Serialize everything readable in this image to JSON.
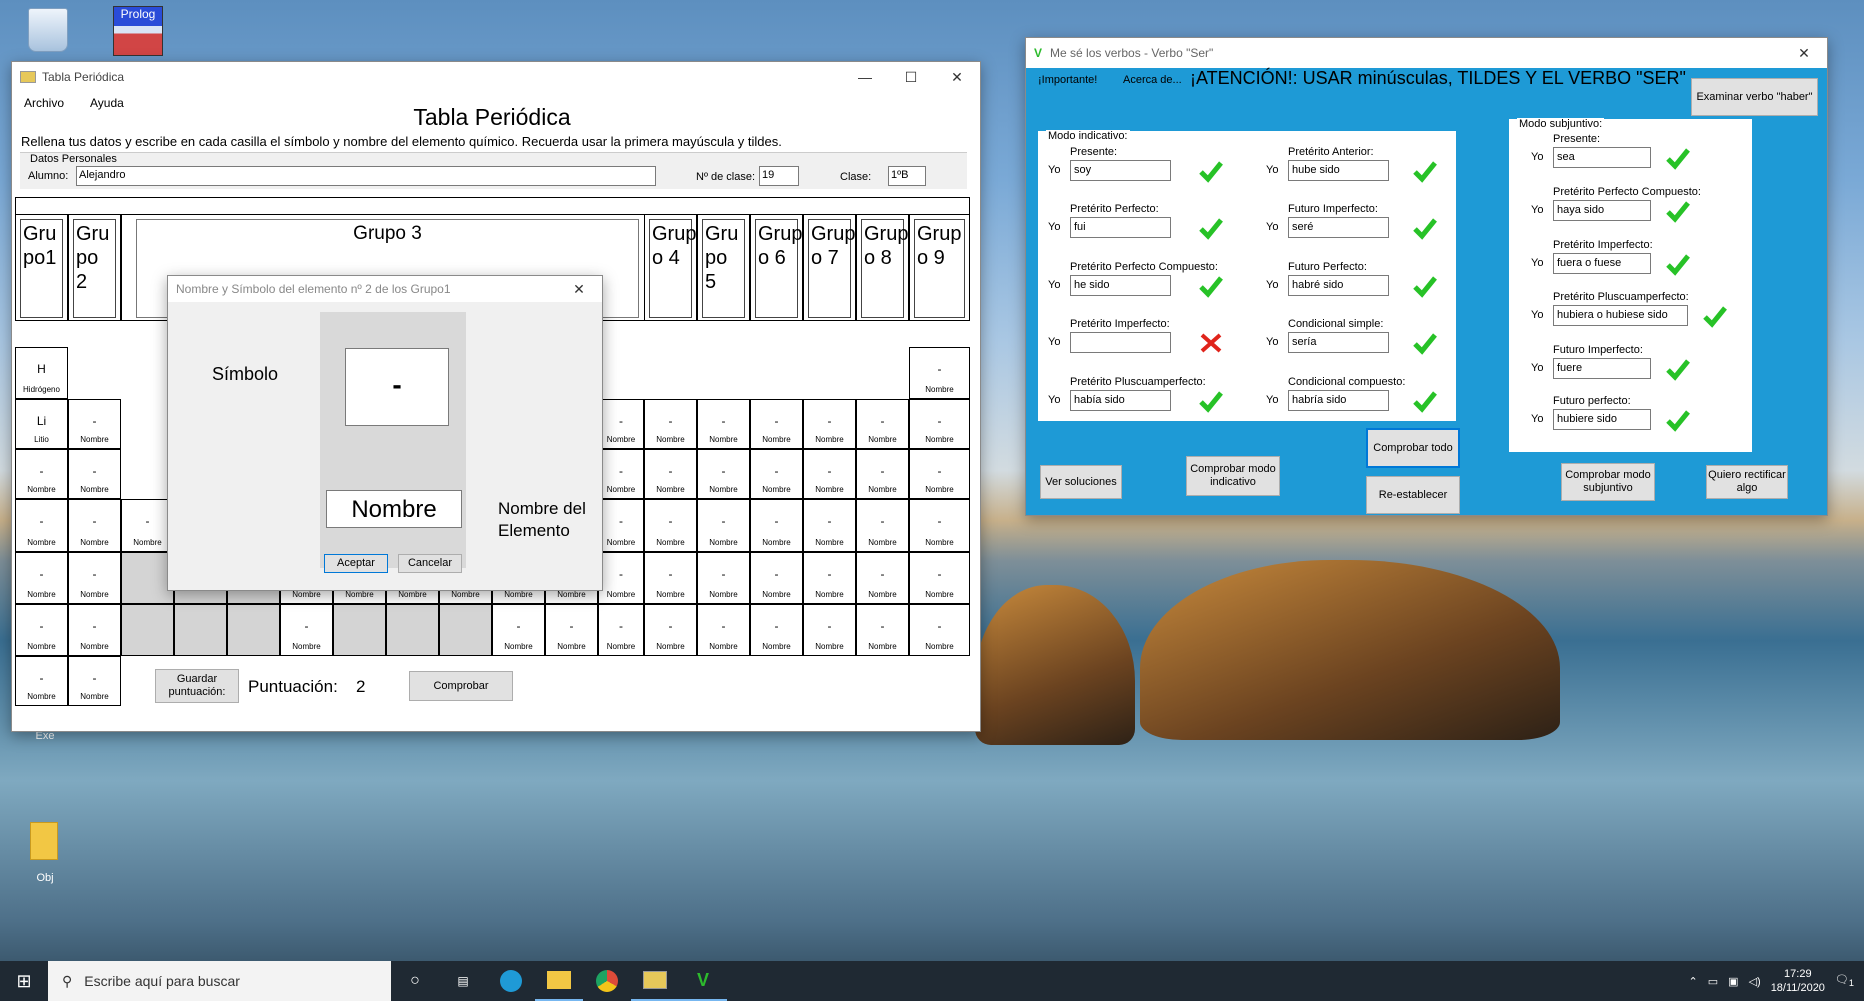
{
  "desktop": {
    "icon_exe": "Exe",
    "icon_obj": "Obj",
    "prolog": "Prolog"
  },
  "tabla": {
    "title": "Tabla Periódica",
    "menu": [
      "Archivo",
      "Ayuda"
    ],
    "heading": "Tabla Periódica",
    "instructions": "Rellena tus datos y escribe en cada casilla el símbolo y nombre del elemento químico. Recuerda usar la primera mayúscula y tildes.",
    "datos_legend": "Datos Personales",
    "alumno_label": "Alumno:",
    "alumno_value": "Alejandro",
    "nclase_label": "Nº de clase:",
    "nclase_value": "19",
    "clase_label": "Clase:",
    "clase_value": "1ºB",
    "groups": [
      "Gru po1",
      "Gru po 2",
      "Grupo 3",
      "Grup o 4",
      "Gru po 5",
      "Grup o 6",
      "Grup o 7",
      "Grup o 8",
      "Grup o 9"
    ],
    "h_symbol": "H",
    "h_name": "Hidrógeno",
    "li_symbol": "Li",
    "li_name": "Litio",
    "empty_symbol": "-",
    "empty_name": "Nombre",
    "save_button": "Guardar puntuación:",
    "score_label": "Puntuación:",
    "score_value": "2",
    "check_button": "Comprobar"
  },
  "dialog": {
    "title": "Nombre y Símbolo del elemento nº 2 de los Grupo1",
    "simbolo_label": "Símbolo",
    "symbol_value": "-",
    "name_value": "Nombre",
    "nombre_label": "Nombre del Elemento",
    "ok": "Aceptar",
    "cancel": "Cancelar"
  },
  "verbos": {
    "title": "Me sé los verbos - Verbo \"Ser\"",
    "menu": [
      "¡Importante!",
      "Acerca de..."
    ],
    "warning": "¡ATENCIÓN!: USAR minúsculas, TILDES Y EL VERBO \"SER\"",
    "examinar": "Examinar verbo \"haber\"",
    "ind_legend": "Modo indicativo:",
    "subj_legend": "Modo subjuntivo:",
    "yo": "Yo",
    "indicativo": [
      {
        "label": "Presente:",
        "value": "soy",
        "ok": true
      },
      {
        "label": "Pretérito Perfecto:",
        "value": "fui",
        "ok": true
      },
      {
        "label": "Pretérito Perfecto Compuesto:",
        "value": "he sido",
        "ok": true
      },
      {
        "label": "Pretérito Imperfecto:",
        "value": "",
        "ok": false
      },
      {
        "label": "Pretérito Pluscuamperfecto:",
        "value": "había sido",
        "ok": true
      },
      {
        "label": "Pretérito Anterior:",
        "value": "hube sido",
        "ok": true
      },
      {
        "label": "Futuro Imperfecto:",
        "value": "seré",
        "ok": true
      },
      {
        "label": "Futuro Perfecto:",
        "value": "habré sido",
        "ok": true
      },
      {
        "label": "Condicional simple:",
        "value": "sería",
        "ok": true
      },
      {
        "label": "Condicional compuesto:",
        "value": "habría sido",
        "ok": true
      }
    ],
    "subjuntivo": [
      {
        "label": "Presente:",
        "value": "sea",
        "ok": true
      },
      {
        "label": "Pretérito Perfecto Compuesto:",
        "value": "haya sido",
        "ok": true
      },
      {
        "label": "Pretérito Imperfecto:",
        "value": "fuera o fuese",
        "ok": true
      },
      {
        "label": "Pretérito Pluscuamperfecto:",
        "value": "hubiera o hubiese sido",
        "ok": true
      },
      {
        "label": "Futuro Imperfecto:",
        "value": "fuere",
        "ok": true
      },
      {
        "label": "Futuro perfecto:",
        "value": "hubiere sido",
        "ok": true
      }
    ],
    "ver_soluciones": "Ver soluciones",
    "comprobar_ind": "Comprobar modo indicativo",
    "comprobar_todo": "Comprobar todo",
    "reestablecer": "Re-establecer",
    "comprobar_subj": "Comprobar modo subjuntivo",
    "rectificar": "Quiero rectificar algo"
  },
  "taskbar": {
    "search_placeholder": "Escribe aquí para buscar",
    "time": "17:29",
    "date": "18/11/2020",
    "notif_count": "1"
  },
  "colors": {
    "check_green": "#27c227",
    "cross_red": "#e0241b",
    "accent": "#0078d7"
  }
}
